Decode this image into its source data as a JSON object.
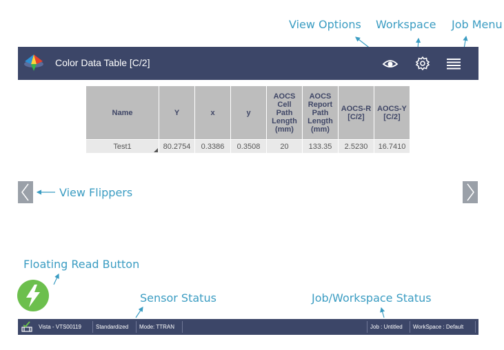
{
  "annotations": {
    "view_options": "View Options",
    "workspace": "Workspace",
    "job_menu": "Job Menu",
    "view_flippers": "View Flippers",
    "floating_read_button": "Floating Read Button",
    "sensor_status": "Sensor Status",
    "job_workspace_status": "Job/Workspace Status"
  },
  "header": {
    "title": "Color Data Table [C/2]",
    "icons": [
      "eye-icon",
      "gear-icon",
      "hamburger-menu-icon"
    ]
  },
  "table": {
    "columns": [
      [
        "Name"
      ],
      [
        "Y"
      ],
      [
        "x"
      ],
      [
        "y"
      ],
      [
        "AOCS",
        "Cell Path",
        "Length",
        "(mm)"
      ],
      [
        "AOCS",
        "Report",
        "Path",
        "Length",
        "(mm)"
      ],
      [
        "AOCS-R",
        "[C/2]"
      ],
      [
        "AOCS-Y",
        "[C/2]"
      ]
    ],
    "rows": [
      [
        "Test1",
        "80.2754",
        "0.3386",
        "0.3508",
        "20",
        "133.35",
        "2.5230",
        "16.7410"
      ]
    ]
  },
  "status_bar": {
    "device": "Vista - VTS00119",
    "standardization": "Standardized",
    "mode": "Mode: TTRAN",
    "job": "Job : Untitled",
    "workspace": "WorkSpace : Default"
  },
  "colors": {
    "header_bg": "#3c4668",
    "annotation": "#3a9cc2",
    "fab": "#6cbf4d",
    "table_header_bg": "#bdbdbd",
    "flipper": "#9aa0a8"
  }
}
